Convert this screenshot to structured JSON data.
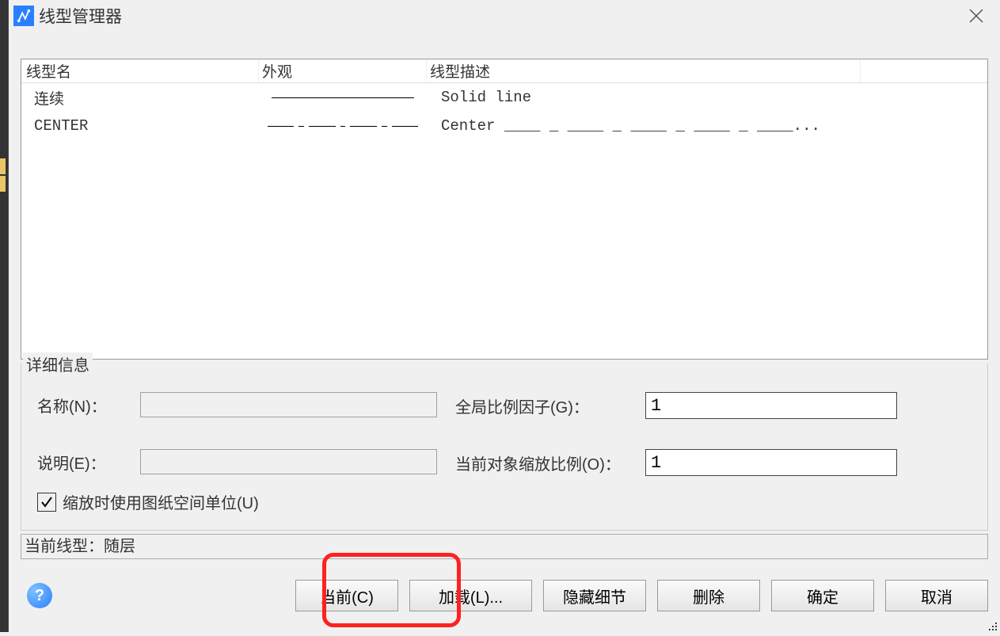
{
  "title": "线型管理器",
  "table": {
    "headers": {
      "name": "线型名",
      "appearance": "外观",
      "desc": "线型描述"
    },
    "rows": [
      {
        "name": "连续",
        "type": "solid",
        "desc": "Solid line"
      },
      {
        "name": "CENTER",
        "type": "center",
        "desc": "Center ____ _ ____ _ ____ _ ____ _ ____..."
      }
    ]
  },
  "details": {
    "legend": "详细信息",
    "name_label": "名称(N)：",
    "name_value": "",
    "desc_label": "说明(E)：",
    "desc_value": "",
    "global_label": "全局比例因子(G)：",
    "global_value": "1",
    "scale_label": "当前对象缩放比例(O)：",
    "scale_value": "1",
    "checkbox_label": "缩放时使用图纸空间单位(U)",
    "checked": true
  },
  "status": "当前线型：随层",
  "buttons": {
    "help": "?",
    "current": "当前(C)",
    "load": "加载(L)...",
    "hide_details": "隐藏细节",
    "delete": "删除",
    "ok": "确定",
    "cancel": "取消"
  }
}
